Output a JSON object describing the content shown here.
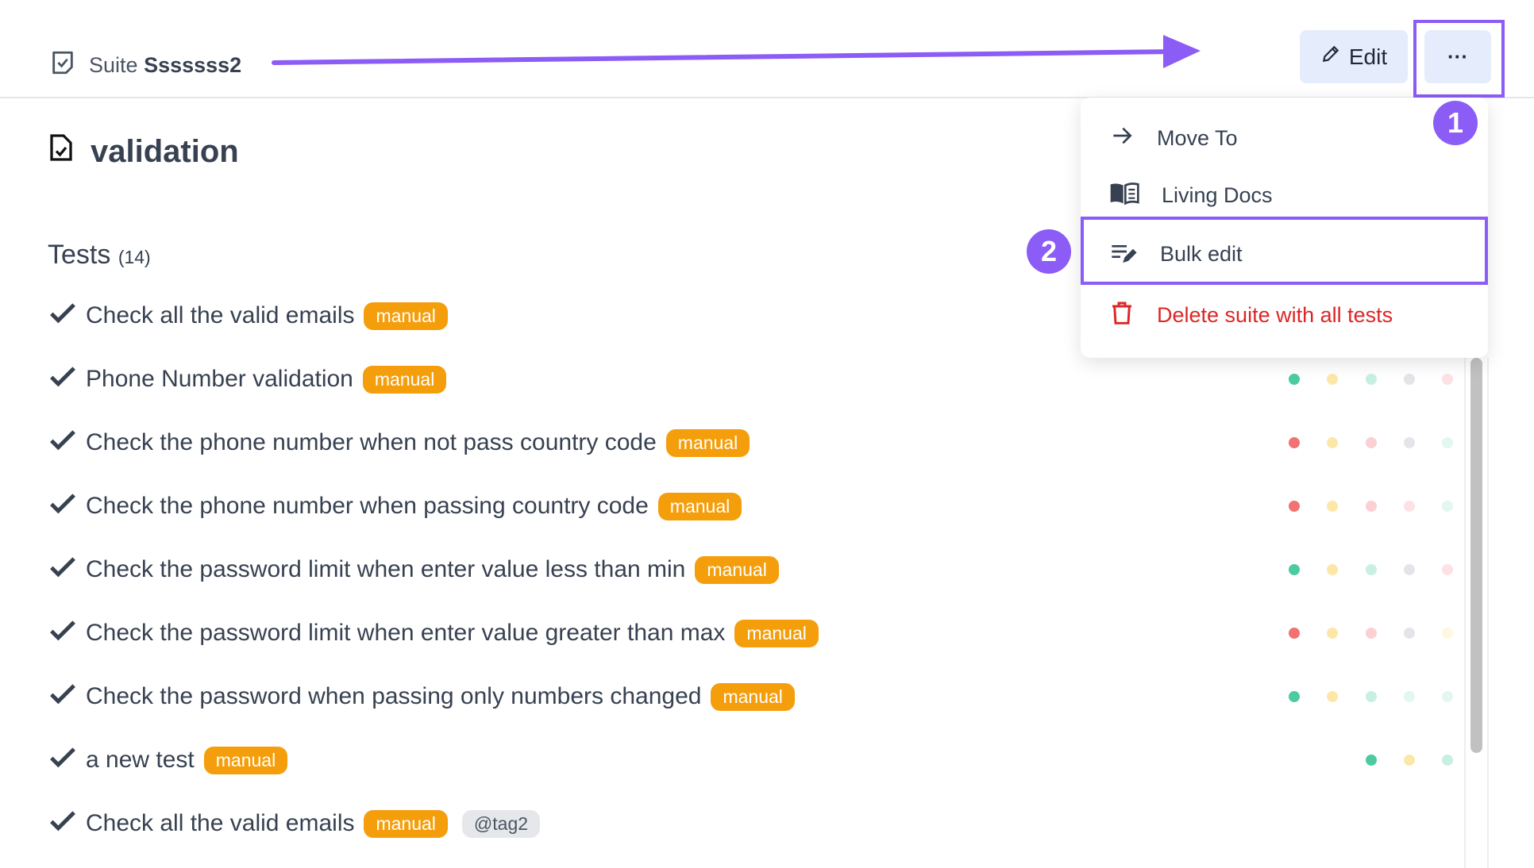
{
  "header": {
    "suite_label": "Suite",
    "suite_name": "Sssssss2",
    "edit_label": "Edit",
    "more_label": "···"
  },
  "title": "validation",
  "tests": {
    "heading": "Tests",
    "count": "(14)",
    "items": [
      {
        "name": "Check all the valid emails",
        "badge": "manual",
        "runs": []
      },
      {
        "name": "Phone Number validation",
        "badge": "manual",
        "runs": [
          "passed",
          "pending",
          "passed-faint",
          "none",
          "failed-faint"
        ]
      },
      {
        "name": "Check the phone number when not pass country code",
        "badge": "manual",
        "runs": [
          "failed",
          "pending",
          "failed-light",
          "none",
          "passed-faintest"
        ]
      },
      {
        "name": "Check the phone number when passing country code",
        "badge": "manual",
        "runs": [
          "failed",
          "pending",
          "failed-light",
          "failed-faint",
          "passed-faintest"
        ]
      },
      {
        "name": "Check the password limit when enter value less than min",
        "badge": "manual",
        "runs": [
          "passed",
          "pending",
          "passed-faint",
          "none",
          "failed-faint"
        ]
      },
      {
        "name": "Check the password limit when enter value greater than max",
        "badge": "manual",
        "runs": [
          "failed",
          "pending",
          "failed-light",
          "none",
          "pending-faint"
        ]
      },
      {
        "name": "Check the password when passing only numbers changed",
        "badge": "manual",
        "runs": [
          "passed",
          "pending",
          "passed-faint",
          "passed-faintest",
          "passed-faintest"
        ]
      },
      {
        "name": "a new test",
        "badge": "manual",
        "runs": [
          "",
          "",
          "passed",
          "pending",
          "passed-faint"
        ]
      },
      {
        "name": "Check all the valid emails",
        "badge": "manual",
        "tag": "@tag2",
        "runs": []
      }
    ]
  },
  "menu": {
    "items": [
      {
        "label": "Move To",
        "icon": "arrow-right-icon"
      },
      {
        "label": "Living Docs",
        "icon": "book-icon"
      },
      {
        "label": "Bulk edit",
        "icon": "bulk-edit-icon"
      },
      {
        "label": "Delete suite with all tests",
        "icon": "trash-icon"
      }
    ]
  },
  "annotations": {
    "step1": "1",
    "step2": "2"
  },
  "colors": {
    "accent": "#8b5cf6",
    "badge": "#f59e0b",
    "danger": "#dc2626",
    "passed": "#4ccb9f",
    "failed": "#f07272",
    "pending": "#fde7a8",
    "passed-faint": "#c7f0e2",
    "passed-faintest": "#e2f7f1",
    "failed-light": "#fbd0d3",
    "failed-faint": "#fde1e4",
    "pending-faint": "#fef8e1",
    "none": "#e3e5e8"
  }
}
